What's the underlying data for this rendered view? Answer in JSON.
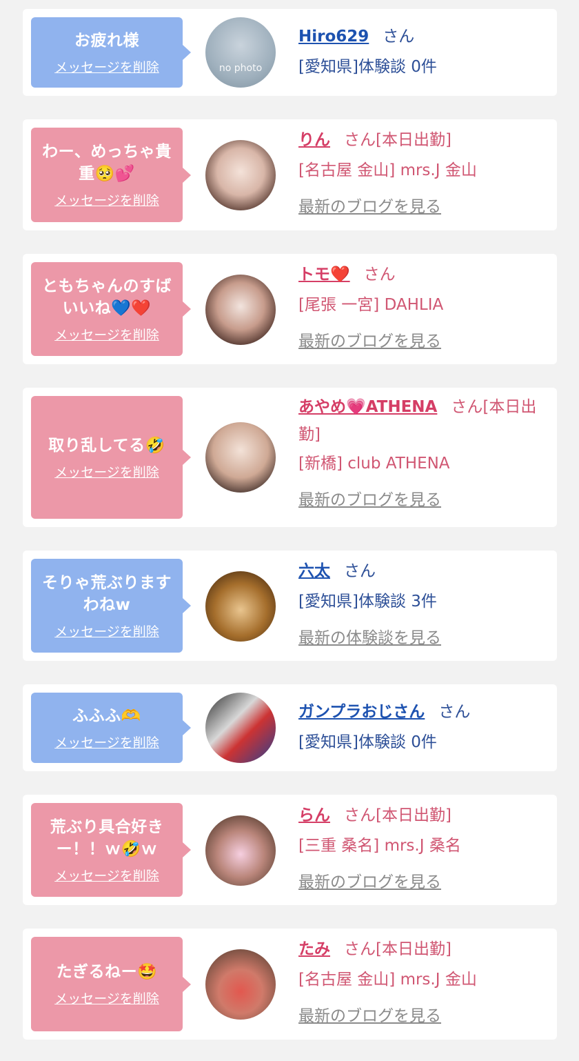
{
  "delete_label": "メッセージを削除",
  "items": [
    {
      "theme": "blue",
      "message": "お疲れ様",
      "name": "Hiro629",
      "honorific": "さん",
      "detail": "[愛知県]体験談 0件",
      "link": "",
      "avatar_text": "no photo"
    },
    {
      "theme": "pink",
      "message": "わー、めっちゃ貴重🥺💕",
      "name": "りん",
      "honorific": "さん[本日出勤]",
      "detail": "[名古屋 金山] mrs.J 金山",
      "link": "最新のブログを見る"
    },
    {
      "theme": "pink",
      "message": "ともちゃんのすばいいね💙❤️",
      "name": "トモ❤️",
      "honorific": "さん",
      "detail": "[尾張 一宮] DAHLIA",
      "link": "最新のブログを見る"
    },
    {
      "theme": "pink",
      "message": "取り乱してる🤣",
      "name": "あやめ💗ATHENA",
      "honorific": "さん[本日出勤]",
      "detail": "[新橋] club ATHENA",
      "link": "最新のブログを見る"
    },
    {
      "theme": "blue",
      "message": "そりゃ荒ぶりますわねw",
      "name": "六太",
      "honorific": "さん",
      "detail": "[愛知県]体験談 3件",
      "link": "最新の体験談を見る"
    },
    {
      "theme": "blue",
      "message": "ふふふ🫶",
      "name": "ガンプラおじさん",
      "honorific": "さん",
      "detail": "[愛知県]体験談 0件",
      "link": ""
    },
    {
      "theme": "pink",
      "message": "荒ぶり具合好きー！！ｗ🤣ｗ",
      "name": "らん",
      "honorific": "さん[本日出勤]",
      "detail": "[三重 桑名] mrs.J 桑名",
      "link": "最新のブログを見る"
    },
    {
      "theme": "pink",
      "message": "たぎるねー🤩",
      "name": "たみ",
      "honorific": "さん[本日出勤]",
      "detail": "[名古屋 金山] mrs.J 金山",
      "link": "最新のブログを見る"
    }
  ]
}
